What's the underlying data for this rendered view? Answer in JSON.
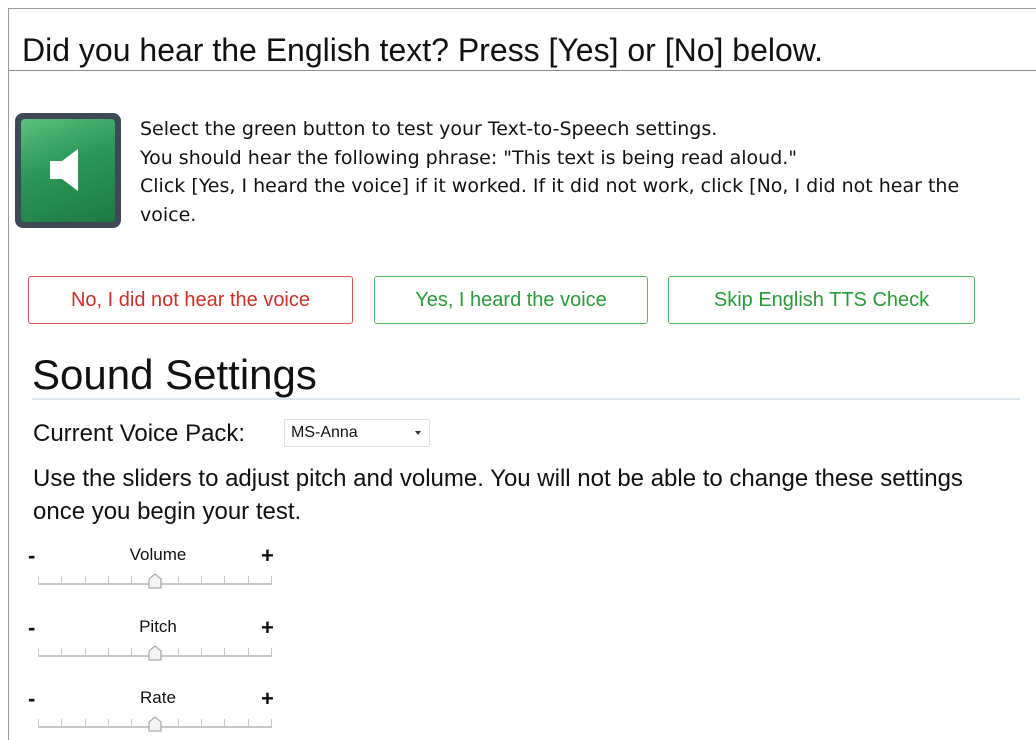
{
  "header": {
    "title": "Did you hear the English text? Press [Yes] or [No] below."
  },
  "tts_check": {
    "speaker_icon": "speaker-icon",
    "accent_color": "#2f9a59",
    "instructions": [
      "Select the green button to test your Text-to-Speech settings.",
      "You should hear the following phrase: \"This text is being read aloud.\"",
      "Click [Yes, I heard the voice] if it worked. If it did not work, click [No, I did not hear the voice."
    ],
    "buttons": {
      "no_label": "No, I did not hear the voice",
      "yes_label": "Yes, I heard the voice",
      "skip_label": "Skip English TTS Check",
      "no_color": "#c9302c",
      "yes_color": "#2a9a3a"
    }
  },
  "sound_settings": {
    "title": "Sound Settings",
    "voice_pack_label": "Current Voice Pack:",
    "voice_pack_selected": "MS-Anna",
    "slider_note": "Use the sliders to adjust pitch and volume. You will not be able to change these settings once you begin your test.",
    "sliders": [
      {
        "label": "Volume",
        "minus": "-",
        "plus": "+",
        "value": 0.5
      },
      {
        "label": "Pitch",
        "minus": "-",
        "plus": "+",
        "value": 0.5
      },
      {
        "label": "Rate",
        "minus": "-",
        "plus": "+",
        "value": 0.5
      }
    ]
  }
}
